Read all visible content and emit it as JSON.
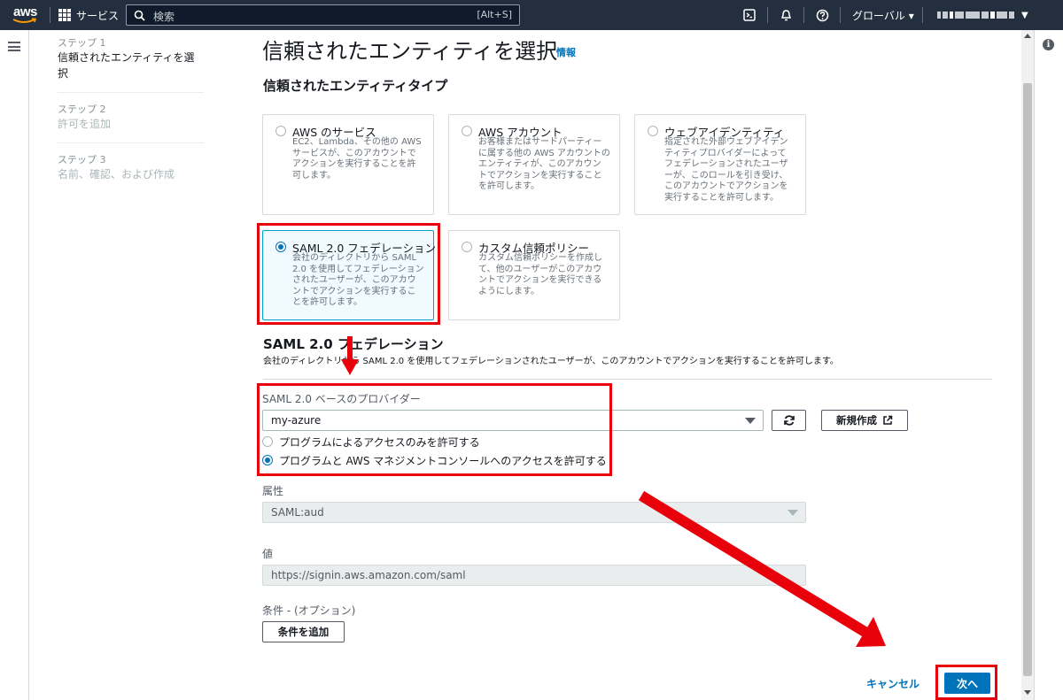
{
  "topbar": {
    "logo_text": "aws",
    "services_label": "サービス",
    "search_placeholder": "検索",
    "search_shortcut": "[Alt+S]",
    "region_label": "グローバル ▾"
  },
  "steps": [
    {
      "label": "ステップ 1",
      "name": "信頼されたエンティティを選択",
      "active": true
    },
    {
      "label": "ステップ 2",
      "name": "許可を追加",
      "active": false
    },
    {
      "label": "ステップ 3",
      "name": "名前、確認、および作成",
      "active": false
    }
  ],
  "page": {
    "title": "信頼されたエンティティを選択",
    "info_link": "情報",
    "entity_type_heading": "信頼されたエンティティタイプ"
  },
  "tiles": [
    {
      "title": "AWS のサービス",
      "desc": [
        "EC2、Lambda、その他の AWS",
        "サービスが、このアカウントで",
        "アクションを実行することを許",
        "可します。"
      ],
      "selected": false
    },
    {
      "title": "AWS アカウント",
      "desc": [
        "お客様またはサードパーティー",
        "に属する他の AWS アカウントの",
        "エンティティが、このアカウン",
        "トでアクションを実行すること",
        "を許可します。"
      ],
      "selected": false
    },
    {
      "title": "ウェブアイデンティティ",
      "desc": [
        "指定された外部ウェブアイデン",
        "ティティプロバイダーによって",
        "フェデレーションされたユーザ",
        "ーが、このロールを引き受け、",
        "このアカウントでアクションを",
        "実行することを許可します。"
      ],
      "selected": false
    },
    {
      "title": "SAML 2.0 フェデレーション",
      "desc": [
        "会社のディレクトリから SAML",
        "2.0 を使用してフェデレーション",
        "されたユーザーが、このアカウ",
        "ントでアクションを実行するこ",
        "とを許可します。"
      ],
      "selected": true
    },
    {
      "title": "カスタム信頼ポリシー",
      "desc": [
        "カスタム信頼ポリシーを作成し",
        "て、他のユーザーがこのアカウ",
        "ントでアクションを実行できる",
        "ようにします。"
      ],
      "selected": false
    }
  ],
  "saml": {
    "heading": "SAML 2.0 フェデレーション",
    "description": "会社のディレクトリから SAML 2.0 を使用してフェデレーションされたユーザーが、このアカウントでアクションを実行することを許可します。",
    "provider_label": "SAML 2.0 ベースのプロバイダー",
    "provider_value": "my-azure",
    "create_new_label": "新規作成",
    "access_options": [
      {
        "label": "プログラムによるアクセスのみを許可する",
        "selected": false
      },
      {
        "label": "プログラムと AWS マネジメントコンソールへのアクセスを許可する",
        "selected": true
      }
    ]
  },
  "attribute": {
    "label": "属性",
    "value": "SAML:aud"
  },
  "value_field": {
    "label": "値",
    "value": "https://signin.aws.amazon.com/saml"
  },
  "condition": {
    "label": "条件 - (オプション)",
    "add_button": "条件を追加"
  },
  "footer": {
    "cancel_label": "キャンセル",
    "next_label": "次へ"
  },
  "colors": {
    "highlight": "#e8000b",
    "primary": "#0073bb",
    "topbar": "#232f3e"
  }
}
